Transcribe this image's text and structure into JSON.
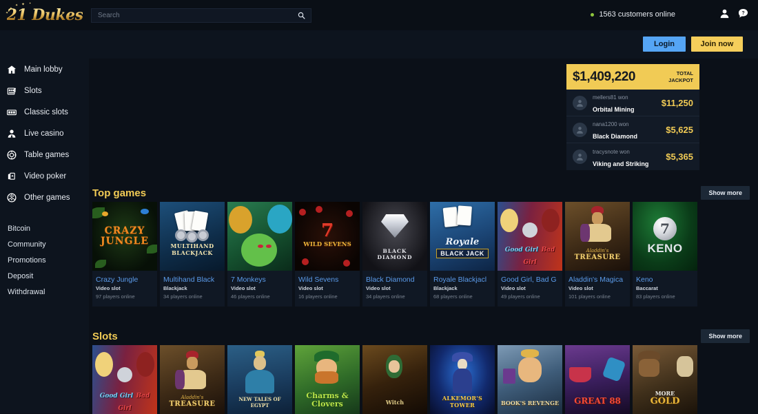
{
  "brand": {
    "name": "21 Dukes",
    "name_part1": "21",
    "name_part2": "Dukes"
  },
  "search": {
    "placeholder": "Search",
    "value": "",
    "icon": "search-icon"
  },
  "header": {
    "online_text": "1563 customers online",
    "user_icon": "user-icon",
    "help_icon": "help-icon",
    "login_label": "Login",
    "join_label": "Join now"
  },
  "sidebar": {
    "items": [
      {
        "label": "Main lobby",
        "icon": "home-icon"
      },
      {
        "label": "Slots",
        "icon": "slot-machine-icon"
      },
      {
        "label": "Classic slots",
        "icon": "classic-slot-icon"
      },
      {
        "label": "Live casino",
        "icon": "dealer-icon"
      },
      {
        "label": "Table games",
        "icon": "chip-icon"
      },
      {
        "label": "Video poker",
        "icon": "cards-icon"
      },
      {
        "label": "Other games",
        "icon": "dice-icon"
      }
    ],
    "links": [
      {
        "label": "Bitcoin"
      },
      {
        "label": "Community"
      },
      {
        "label": "Promotions"
      },
      {
        "label": "Deposit"
      },
      {
        "label": "Withdrawal"
      }
    ]
  },
  "jackpot": {
    "amount": "$1,409,220",
    "label_line1": "TOTAL",
    "label_line2": "JACKPOT",
    "winners": [
      {
        "user": "mellers81 won",
        "game": "Orbital Mining",
        "amount": "$11,250",
        "avatar": "avatar-icon"
      },
      {
        "user": "nana1200 won",
        "game": "Black Diamond",
        "amount": "$5,625",
        "avatar": "avatar-icon"
      },
      {
        "user": "tracysnote won",
        "game": "Viking and Striking",
        "amount": "$5,365",
        "avatar": "avatar-icon"
      }
    ]
  },
  "sections": [
    {
      "title": "Top games",
      "show_more": "Show more",
      "games": [
        {
          "title": "Crazy Jungle",
          "category": "Video slot",
          "players": "97 players online",
          "art": "art-crazyjungle",
          "art_text": "CRAZY JUNGLE"
        },
        {
          "title": "Multihand Black",
          "category": "Blackjack",
          "players": "34 players online",
          "art": "art-blackjack",
          "art_text": "MULTIHAND BLACKJACK"
        },
        {
          "title": "7 Monkeys",
          "category": "Video slot",
          "players": "46 players online",
          "art": "art-monkeys",
          "art_text": ""
        },
        {
          "title": "Wild Sevens",
          "category": "Video slot",
          "players": "16 players online",
          "art": "art-wildsevens",
          "art_text": "WILD SEVENS"
        },
        {
          "title": "Black Diamond",
          "category": "Video slot",
          "players": "34 players online",
          "art": "art-blackdiamond",
          "art_text": "BLACK DIAMOND"
        },
        {
          "title": "Royale Blackjacl",
          "category": "Blackjack",
          "players": "68 players online",
          "art": "art-royale",
          "art_text": "Royale",
          "art_text2": "BLACK JACK"
        },
        {
          "title": "Good Girl, Bad G",
          "category": "Video slot",
          "players": "49 players online",
          "art": "art-goodgirl",
          "art_text": "Good Girl",
          "art_text2": "Bad Girl"
        },
        {
          "title": "Aladdin's Magica",
          "category": "Video slot",
          "players": "101 players online",
          "art": "art-aladdin",
          "art_text": "Aladdin's",
          "art_text2": "TREASURE"
        },
        {
          "title": "Keno",
          "category": "Baccarat",
          "players": "83 players online",
          "art": "art-keno",
          "art_text": "KENO",
          "art_number": "7"
        }
      ]
    },
    {
      "title": "Slots",
      "show_more": "Show more",
      "games": [
        {
          "title": "",
          "category": "",
          "players": "",
          "art": "art-goodgirl",
          "art_text": "Good Girl",
          "art_text2": "Bad Girl"
        },
        {
          "title": "",
          "category": "",
          "players": "",
          "art": "art-aladdin",
          "art_text": "Aladdin's",
          "art_text2": "TREASURE"
        },
        {
          "title": "",
          "category": "",
          "players": "",
          "art": "art-egypt",
          "art_text": "NEW TALES OF EGYPT"
        },
        {
          "title": "",
          "category": "",
          "players": "",
          "art": "art-charms",
          "art_text": "Charms & Clovers"
        },
        {
          "title": "",
          "category": "",
          "players": "",
          "art": "art-witch",
          "art_text": "Witch"
        },
        {
          "title": "",
          "category": "",
          "players": "",
          "art": "art-alkemor",
          "art_text": "ALKEMOR'S TOWER"
        },
        {
          "title": "",
          "category": "",
          "players": "",
          "art": "art-books",
          "art_text": "BOOK'S REVENGE"
        },
        {
          "title": "",
          "category": "",
          "players": "",
          "art": "art-great88",
          "art_text": "GREAT 88"
        },
        {
          "title": "",
          "category": "",
          "players": "",
          "art": "art-moregold",
          "art_text": "MORE",
          "art_text2": "GOLD"
        }
      ]
    }
  ],
  "colors": {
    "gold": "#f1cb55",
    "blue_link": "#5b9bea",
    "login_blue": "#55a5f5",
    "page_bg": "#0b1018",
    "panel_bg": "#0d141e",
    "online_dot": "#8fc63d"
  }
}
